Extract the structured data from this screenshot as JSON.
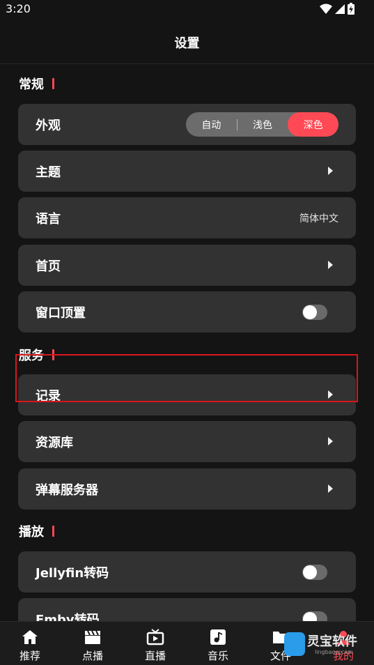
{
  "status_bar": {
    "time": "3:20"
  },
  "header": {
    "title": "设置"
  },
  "sections": {
    "general": {
      "title": "常规"
    },
    "services": {
      "title": "服务"
    },
    "playback": {
      "title": "播放"
    }
  },
  "general_items": {
    "appearance": {
      "label": "外观",
      "options": [
        "自动",
        "浅色",
        "深色"
      ],
      "selected": "深色"
    },
    "theme": {
      "label": "主题"
    },
    "language": {
      "label": "语言",
      "value": "简体中文"
    },
    "home": {
      "label": "首页"
    },
    "pin_window": {
      "label": "窗口顶置",
      "enabled": false
    }
  },
  "service_items": {
    "history": {
      "label": "记录"
    },
    "library": {
      "label": "资源库"
    },
    "danmaku": {
      "label": "弹幕服务器"
    }
  },
  "playback_items": {
    "jellyfin": {
      "label": "Jellyfin转码",
      "enabled": false
    },
    "emby": {
      "label": "Emby转码",
      "enabled": false
    }
  },
  "bottom_nav": [
    {
      "label": "推荐",
      "icon": "home-icon"
    },
    {
      "label": "点播",
      "icon": "clapperboard-icon"
    },
    {
      "label": "直播",
      "icon": "tv-icon"
    },
    {
      "label": "音乐",
      "icon": "music-icon"
    },
    {
      "label": "文件",
      "icon": "folder-icon"
    },
    {
      "label": "我的",
      "icon": "person-icon"
    }
  ],
  "watermark": {
    "title": "灵宝软件",
    "sub": "lingbaow.com"
  },
  "colors": {
    "accent": "#ff4a55",
    "card": "#323232",
    "background": "#141414"
  }
}
